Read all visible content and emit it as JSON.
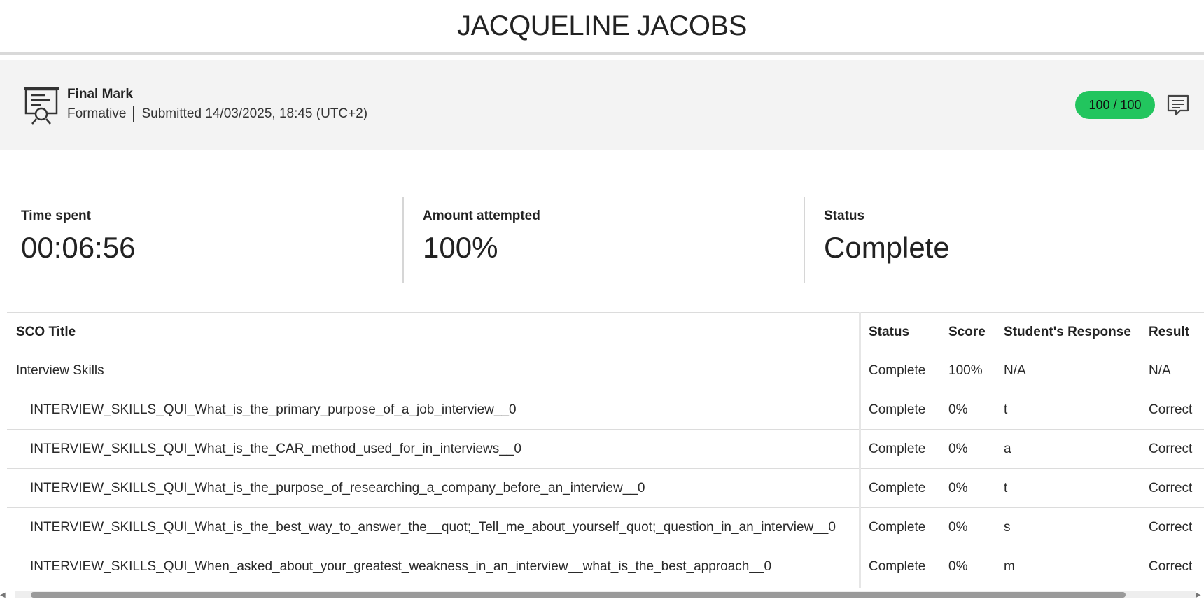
{
  "header": {
    "student_name": "JACQUELINE JACOBS"
  },
  "final_mark": {
    "title": "Final Mark",
    "type": "Formative",
    "submitted": "Submitted 14/03/2025, 18:45 (UTC+2)",
    "score": "100 / 100",
    "badge_color": "#22c55e"
  },
  "stats": {
    "time_spent_label": "Time spent",
    "time_spent_value": "00:06:56",
    "attempted_label": "Amount attempted",
    "attempted_value": "100%",
    "status_label": "Status",
    "status_value": "Complete"
  },
  "table": {
    "headers": {
      "title": "SCO Title",
      "status": "Status",
      "score": "Score",
      "response": "Student's Response",
      "result": "Result"
    },
    "rows": [
      {
        "title": "Interview Skills",
        "status": "Complete",
        "score": "100%",
        "response": "N/A",
        "result": "N/A"
      },
      {
        "title": "INTERVIEW_SKILLS_QUI_What_is_the_primary_purpose_of_a_job_interview__0",
        "status": "Complete",
        "score": "0%",
        "response": "t",
        "result": "Correct"
      },
      {
        "title": "INTERVIEW_SKILLS_QUI_What_is_the_CAR_method_used_for_in_interviews__0",
        "status": "Complete",
        "score": "0%",
        "response": "a",
        "result": "Correct"
      },
      {
        "title": "INTERVIEW_SKILLS_QUI_What_is_the_purpose_of_researching_a_company_before_an_interview__0",
        "status": "Complete",
        "score": "0%",
        "response": "t",
        "result": "Correct"
      },
      {
        "title": "INTERVIEW_SKILLS_QUI_What_is_the_best_way_to_answer_the__quot;_Tell_me_about_yourself_quot;_question_in_an_interview__0",
        "status": "Complete",
        "score": "0%",
        "response": "s",
        "result": "Correct"
      },
      {
        "title": "INTERVIEW_SKILLS_QUI_When_asked_about_your_greatest_weakness_in_an_interview__what_is_the_best_approach__0",
        "status": "Complete",
        "score": "0%",
        "response": "m",
        "result": "Correct"
      }
    ]
  },
  "icons": {
    "certificate": "certificate-icon",
    "feedback": "comment-icon"
  }
}
